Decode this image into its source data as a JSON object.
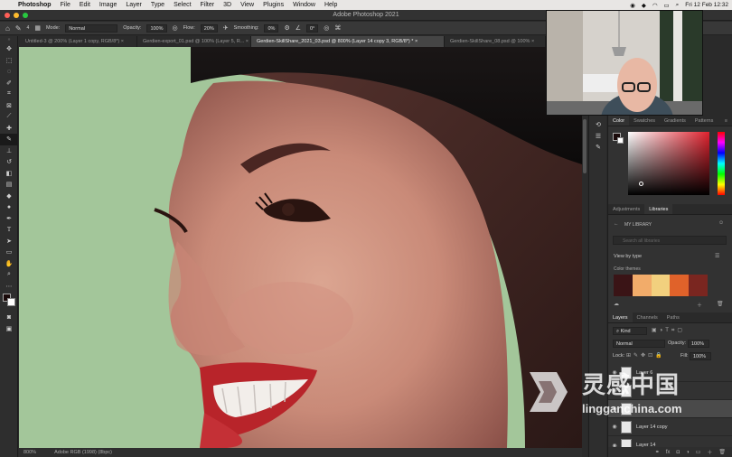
{
  "menubar": {
    "app_name": "Photoshop",
    "items": [
      "File",
      "Edit",
      "Image",
      "Layer",
      "Type",
      "Select",
      "Filter",
      "3D",
      "View",
      "Plugins",
      "Window",
      "Help"
    ],
    "clock": "Fri 12 Feb  12:32"
  },
  "window": {
    "title": "Adobe Photoshop 2021"
  },
  "options_bar": {
    "brush_size": "4",
    "mode_label": "Mode:",
    "mode_value": "Normal",
    "opacity_label": "Opacity:",
    "opacity_value": "100%",
    "flow_label": "Flow:",
    "flow_value": "20%",
    "smoothing_label": "Smoothing:",
    "smoothing_value": "0%",
    "angle_value": "0°"
  },
  "tabs": [
    {
      "label": "Untitled-3 @ 200% (Layer 1 copy, RGB/8*) ×",
      "active": false
    },
    {
      "label": "Gerdien-export_01.psd @ 100% (Layer 5, R... ×",
      "active": false
    },
    {
      "label": "Gerdien-SkillShare_2021_03.psd @ 800% (Layer 14 copy 3, RGB/8*) * ×",
      "active": true
    },
    {
      "label": "Gerdien-SkillShare_08.psd @ 100% ×",
      "active": false
    }
  ],
  "status_bar": {
    "zoom": "800%",
    "profile": "Adobe RGB (1998) (8bpc)"
  },
  "color_panel": {
    "tabs": [
      "Color",
      "Swatches",
      "Gradients",
      "Patterns"
    ],
    "hue_color": "#e0222e"
  },
  "libraries_panel": {
    "tabs": [
      "Adjustments",
      "Libraries"
    ],
    "library_name": "MY LIBRARY",
    "search_placeholder": "Search all libraries",
    "view_label": "View by type",
    "section_label": "Color themes",
    "theme_colors": [
      "#3a1416",
      "#f2ac6a",
      "#f2d07e",
      "#e0622a",
      "#7a2620"
    ]
  },
  "layers_panel": {
    "tabs": [
      "Layers",
      "Channels",
      "Paths"
    ],
    "kind_label": "Kind",
    "blend_mode": "Normal",
    "opacity_label": "Opacity:",
    "opacity_value": "100%",
    "lock_label": "Lock:",
    "fill_label": "Fill:",
    "fill_value": "100%",
    "layers": [
      "Layer 6",
      "",
      "",
      "Layer 14 copy",
      "Layer 14"
    ]
  },
  "watermark": {
    "cn": "灵感中国",
    "url": "lingganchina.com"
  }
}
